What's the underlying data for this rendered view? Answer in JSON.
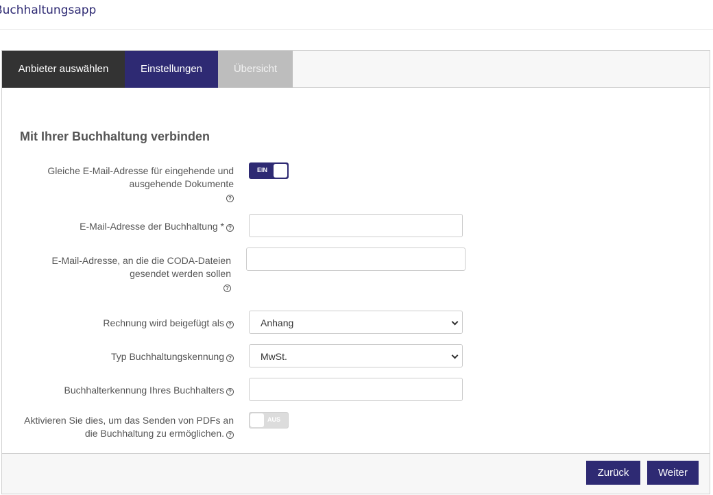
{
  "header": {
    "title": "Buchhaltungsapp"
  },
  "tabs": [
    {
      "label": "Anbieter auswählen",
      "state": "done"
    },
    {
      "label": "Einstellungen",
      "state": "active"
    },
    {
      "label": "Übersicht",
      "state": "disabled"
    }
  ],
  "section": {
    "title": "Mit Ihrer Buchhaltung verbinden"
  },
  "form": {
    "same_email": {
      "label_line1": "Gleiche E-Mail-Adresse für eingehende und",
      "label_line2": "ausgehende Dokumente",
      "toggle_label": "EIN",
      "on": true
    },
    "accounting_email": {
      "label": "E-Mail-Adresse der Buchhaltung *",
      "value": ""
    },
    "coda_email": {
      "label_line1": "E-Mail-Adresse, an die die CODA-Dateien",
      "label_line2": "gesendet werden sollen",
      "value": ""
    },
    "invoice_attached": {
      "label": "Rechnung wird beigefügt als",
      "value": "Anhang"
    },
    "id_type": {
      "label": "Typ Buchhaltungskennung",
      "value": "MwSt."
    },
    "accountant_id": {
      "label": "Buchhalterkennung Ihres Buchhalters",
      "value": ""
    },
    "send_pdf": {
      "label_line1": "Aktivieren Sie dies, um das Senden von PDFs an",
      "label_line2": "die Buchhaltung zu ermöglichen.",
      "toggle_label": "AUS",
      "on": false
    }
  },
  "help_symbol": "?",
  "footer": {
    "back_label": "Zurück",
    "next_label": "Weiter"
  },
  "colors": {
    "accent": "#2e2a73",
    "tab_done": "#333333",
    "tab_disabled": "#bdbdbd"
  }
}
